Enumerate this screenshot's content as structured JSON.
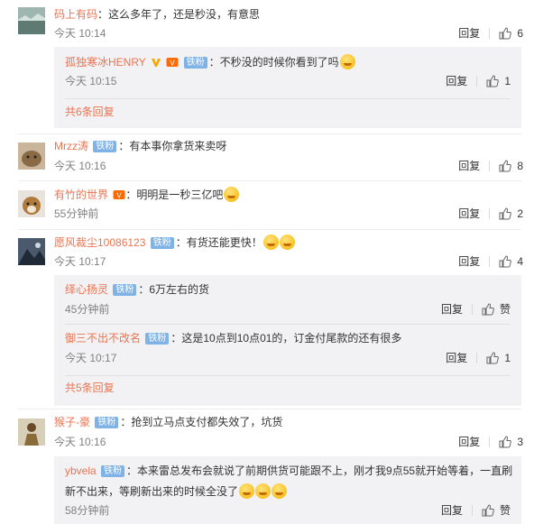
{
  "comments": [
    {
      "user": "码上有码",
      "text": "这么多年了，还是秒没，有意思",
      "time": "今天 10:14",
      "reply_label": "回复",
      "likes": "6",
      "replies": [
        {
          "user": "孤独寒冰HENRY",
          "text": "不秒没的时候你看到了吗",
          "time": "今天 10:15",
          "reply_label": "回复",
          "likes": "1"
        }
      ],
      "more": "共6条回复"
    },
    {
      "user": "Mrzz涛",
      "badge": "铁粉",
      "text": "有本事你拿货来卖呀",
      "time": "今天 10:16",
      "reply_label": "回复",
      "likes": "8"
    },
    {
      "user": "有竹的世界",
      "text": "明明是一秒三亿吧",
      "time": "55分钟前",
      "reply_label": "回复",
      "likes": "2"
    },
    {
      "user": "愿风裁尘10086123",
      "badge": "铁粉",
      "text": "有货还能更快！",
      "time": "今天 10:17",
      "reply_label": "回复",
      "likes": "4",
      "replies": [
        {
          "user": "绎心扬灵",
          "badge": "铁粉",
          "text": "6万左右的货",
          "time": "45分钟前",
          "reply_label": "回复",
          "likes": "赞"
        },
        {
          "user": "御三不出不改名",
          "badge": "铁粉",
          "text": "这是10点到10点01的，订金付尾款的还有很多",
          "time": "今天 10:17",
          "reply_label": "回复",
          "likes": "1"
        }
      ],
      "more": "共5条回复"
    },
    {
      "user": "猴子-豪",
      "badge": "铁粉",
      "text": "抢到立马点支付都失效了，坑货",
      "time": "今天 10:16",
      "reply_label": "回复",
      "likes": "3",
      "replies": [
        {
          "user": "ybvela",
          "badge": "铁粉",
          "text_line1": "本来雷总发布会就说了前期供货可能跟不上，刚才我9点55就开始等着，一直刷",
          "text_line2": "新不出来，等刷新出来的时候全没了",
          "time": "58分钟前",
          "reply_label": "回复",
          "likes": "赞"
        }
      ]
    }
  ],
  "colors": {
    "username": "#eb7350",
    "badge": "#7fb3e6",
    "reply_bg": "#f2f2f5"
  },
  "icons": {
    "like": "thumbs-up-icon",
    "vip": "vip-v-icon",
    "member": "member-badge-icon"
  }
}
